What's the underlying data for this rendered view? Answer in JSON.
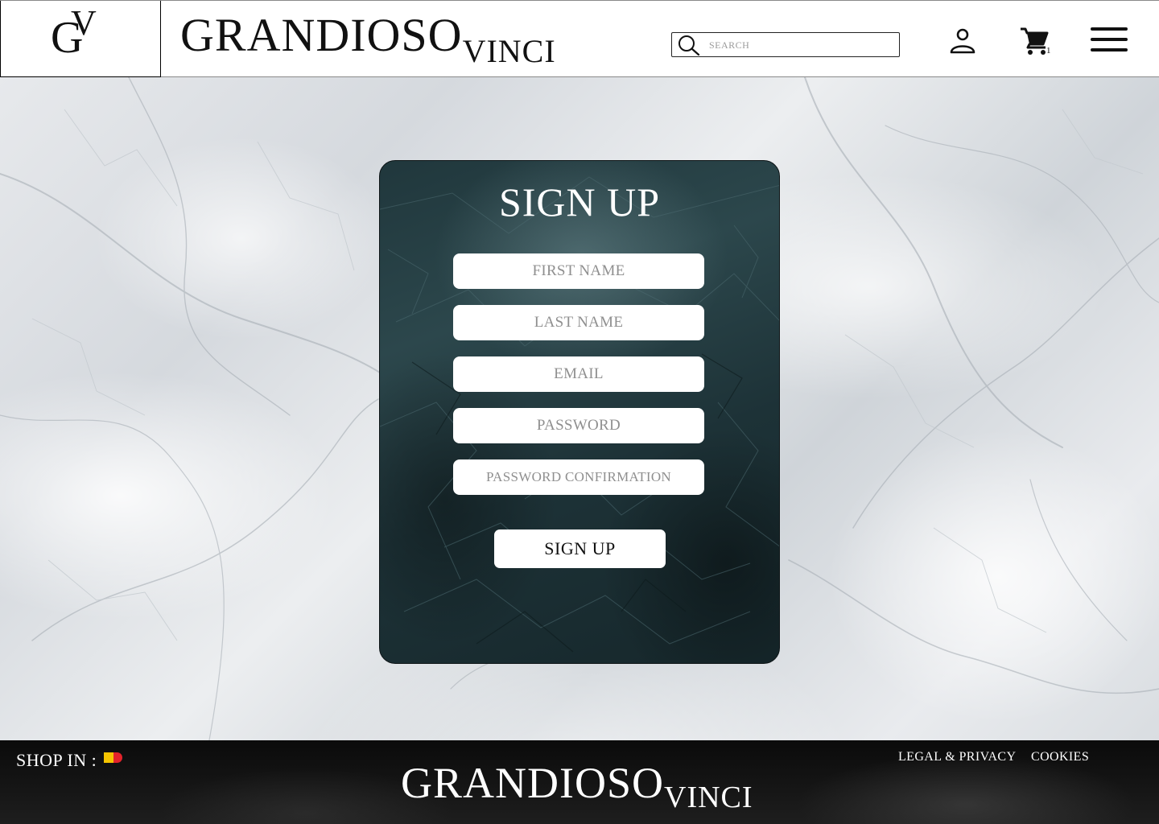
{
  "header": {
    "logo_g": "G",
    "logo_v": "V",
    "brand_big": "GRANDIOSO",
    "brand_small": "VINCI",
    "search_placeholder": "SEARCH",
    "cart_count": "1",
    "icons": [
      "search-icon",
      "user-icon",
      "cart-icon",
      "menu-icon"
    ]
  },
  "signup": {
    "title": "SIGN UP",
    "fields": {
      "first_name": "FIRST NAME",
      "last_name": "LAST NAME",
      "email": "EMAIL",
      "password": "PASSWORD",
      "password_confirmation": "PASSWORD CONFIRMATION"
    },
    "submit_label": "SIGN UP"
  },
  "footer": {
    "shop_in_label": "SHOP IN :",
    "flag_colors": [
      "#111111",
      "#f5c400",
      "#e3232b"
    ],
    "brand_big": "GRANDIOSO",
    "brand_small": "VINCI",
    "links": {
      "legal": "LEGAL & PRIVACY",
      "cookies": "COOKIES"
    }
  },
  "colors": {
    "card_base": "#1f353a",
    "header_bg": "#ffffff",
    "footer_bg": "#111111",
    "text_light": "#ffffff",
    "text_dark": "#111111"
  }
}
